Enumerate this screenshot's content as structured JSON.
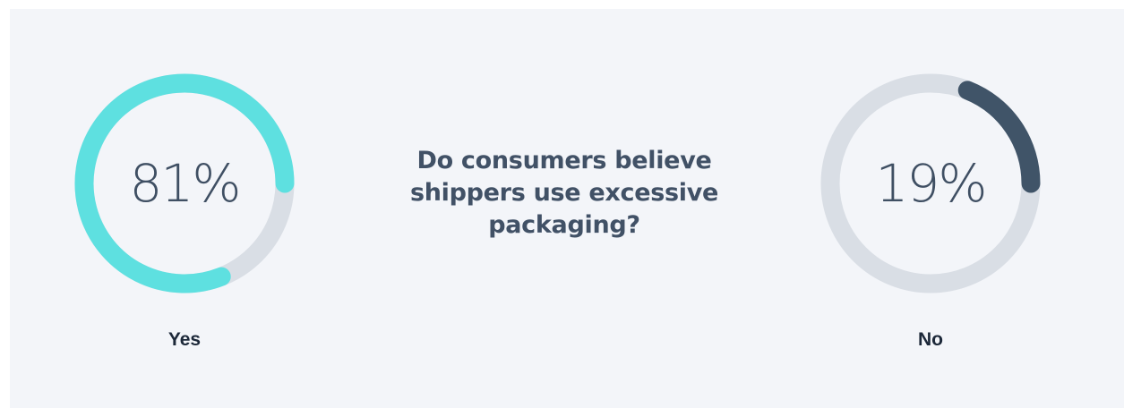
{
  "chart_data": {
    "type": "pie",
    "title": "Do consumers believe shippers use excessive packaging?",
    "slices": [
      {
        "label": "Yes",
        "value": 81,
        "display": "81%",
        "color": "#5ee0e0"
      },
      {
        "label": "No",
        "value": 19,
        "display": "19%",
        "color": "#405468"
      }
    ],
    "track_color": "#d9dee5"
  }
}
